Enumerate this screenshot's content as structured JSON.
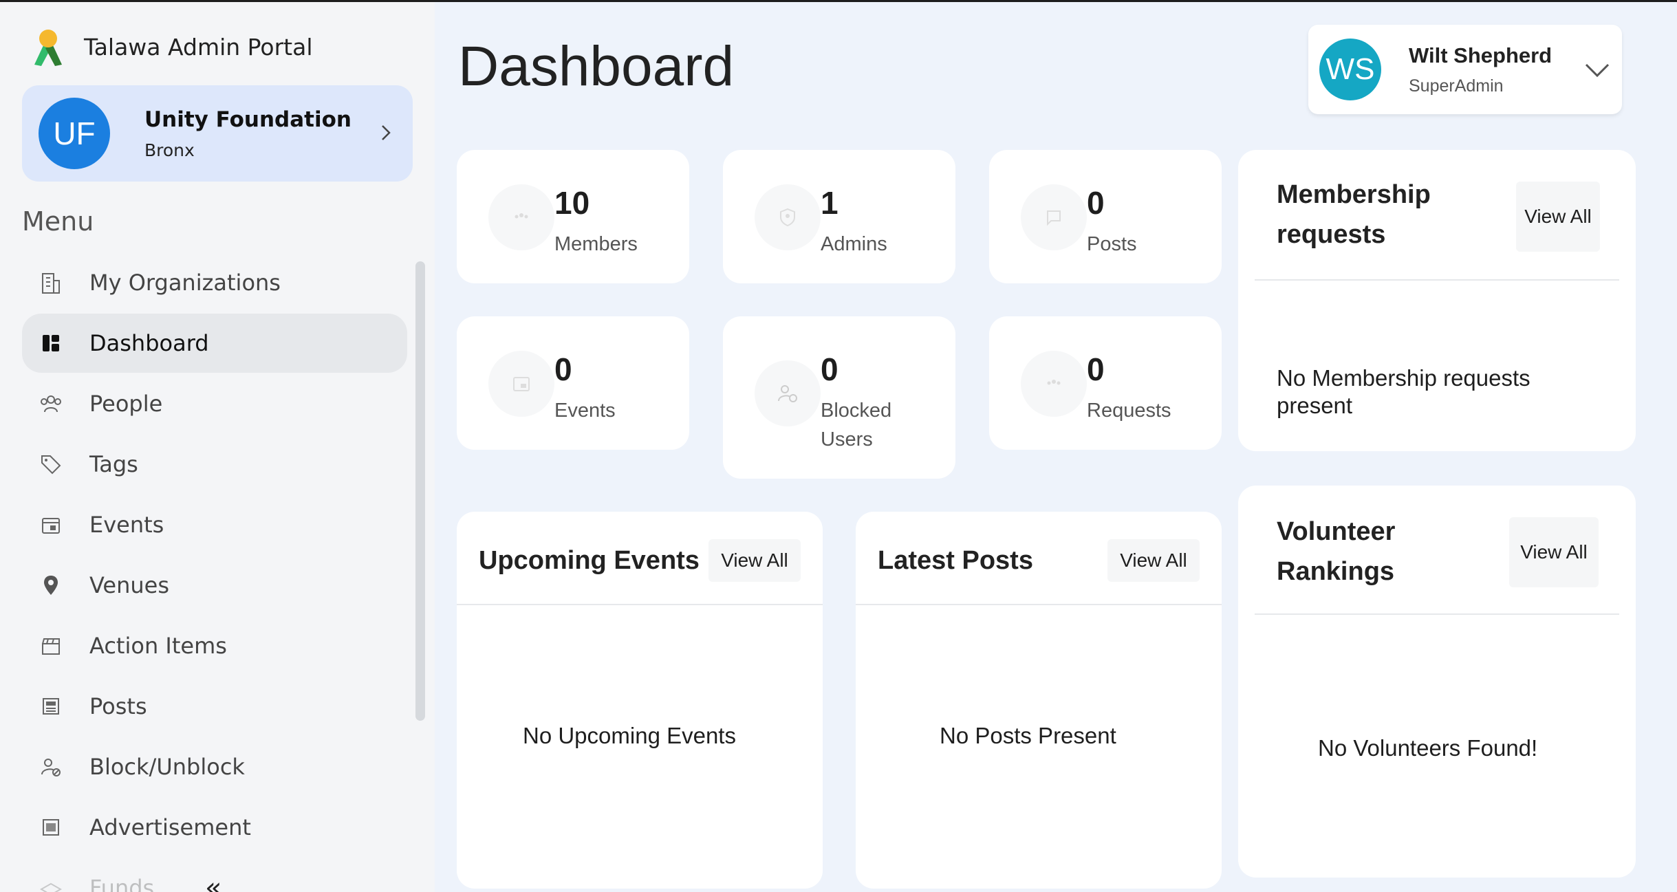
{
  "app": {
    "title": "Talawa Admin Portal"
  },
  "organization": {
    "initials": "UF",
    "name": "Unity Foundation",
    "city": "Bronx"
  },
  "menu": {
    "heading": "Menu",
    "items": [
      {
        "label": "My Organizations",
        "icon": "building-icon"
      },
      {
        "label": "Dashboard",
        "icon": "dashboard-icon",
        "active": true
      },
      {
        "label": "People",
        "icon": "people-icon"
      },
      {
        "label": "Tags",
        "icon": "tag-icon"
      },
      {
        "label": "Events",
        "icon": "calendar-icon"
      },
      {
        "label": "Venues",
        "icon": "location-pin-icon"
      },
      {
        "label": "Action Items",
        "icon": "clapperboard-icon"
      },
      {
        "label": "Posts",
        "icon": "posts-icon"
      },
      {
        "label": "Block/Unblock",
        "icon": "user-block-icon"
      },
      {
        "label": "Advertisement",
        "icon": "advertisement-icon"
      },
      {
        "label": "Funds",
        "icon": "funds-icon"
      }
    ],
    "collapse_glyph": "«"
  },
  "page": {
    "title": "Dashboard"
  },
  "user": {
    "initials": "WS",
    "name": "Wilt Shepherd",
    "role": "SuperAdmin"
  },
  "stats": [
    {
      "value": "10",
      "label": "Members",
      "icon": "members-icon"
    },
    {
      "value": "1",
      "label": "Admins",
      "icon": "admin-shield-icon"
    },
    {
      "value": "0",
      "label": "Posts",
      "icon": "chat-bubble-icon"
    },
    {
      "value": "0",
      "label": "Events",
      "icon": "events-icon"
    },
    {
      "value": "0",
      "label": "Blocked Users",
      "icon": "blocked-user-icon"
    },
    {
      "value": "0",
      "label": "Requests",
      "icon": "requests-icon"
    }
  ],
  "membership": {
    "title": "Membership requests",
    "view_all": "View All",
    "empty": "No Membership requests present"
  },
  "upcoming_events": {
    "title": "Upcoming Events",
    "view_all": "View All",
    "empty": "No Upcoming Events"
  },
  "latest_posts": {
    "title": "Latest Posts",
    "view_all": "View All",
    "empty": "No Posts Present"
  },
  "volunteers": {
    "title": "Volunteer Rankings",
    "view_all": "View All",
    "empty": "No Volunteers Found!"
  },
  "colors": {
    "page_bg": "#eef3fb",
    "sidebar_bg": "#f4f5f7",
    "org_card_bg": "#dde7fb",
    "org_avatar": "#1b7fe0",
    "user_avatar": "#15a7c4",
    "active_item_bg": "#e6e8eb"
  }
}
